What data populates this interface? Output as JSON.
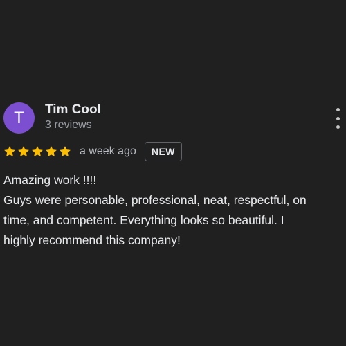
{
  "review": {
    "author": {
      "initial": "T",
      "name": "Tim Cool",
      "meta": "3 reviews",
      "avatar_color": "#7b4fd0"
    },
    "rating": 5,
    "star_icon": "star-icon",
    "star_color": "#fbbc04",
    "time_ago": "a week ago",
    "badge": "NEW",
    "more_icon": "more-vert-icon",
    "text_lines": [
      "Amazing work !!!!",
      "Guys were personable, professional, neat, respectful, on",
      "time, and competent. Everything looks so beautiful. I",
      "highly recommend this company!"
    ]
  }
}
